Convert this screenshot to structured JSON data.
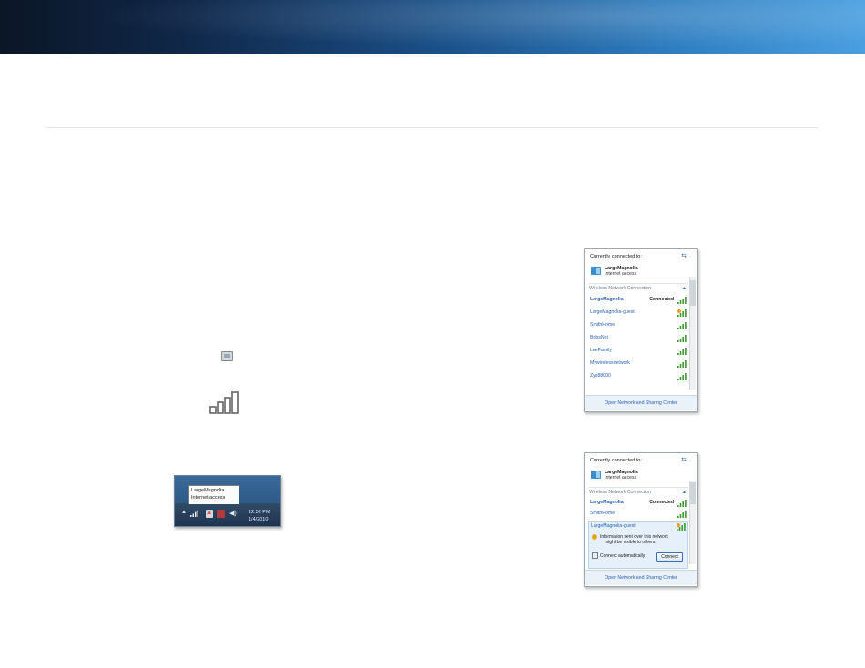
{
  "tray": {
    "tooltip_name": "LargeMagnolia",
    "tooltip_status": "Internet access",
    "time": "12:52 PM",
    "date": "1/4/2010"
  },
  "panel_a": {
    "header": "Currently connected to:",
    "connected_name": "LargeMagnolia",
    "connected_status": "Internet access",
    "section": "Wireless Network Connection",
    "networks": [
      {
        "name": "LargeMagnolia",
        "status": "Connected"
      },
      {
        "name": "LargeMagnolia-guest",
        "status": ""
      },
      {
        "name": "SmithHome",
        "status": ""
      },
      {
        "name": "BobsNet",
        "status": ""
      },
      {
        "name": "LeeFamily",
        "status": ""
      },
      {
        "name": "Mywirelessnetwork",
        "status": ""
      },
      {
        "name": "Zyx88000",
        "status": ""
      }
    ],
    "footer": "Open Network and Sharing Center"
  },
  "panel_b": {
    "header": "Currently connected to:",
    "connected_name": "LargeMagnolia",
    "connected_status": "Internet access",
    "section": "Wireless Network Connection",
    "networks": [
      {
        "name": "LargeMagnolia",
        "status": "Connected"
      },
      {
        "name": "SmithHome",
        "status": ""
      }
    ],
    "selected_network": "LargeMagnolia-guest",
    "warning_line1": "Information sent over this network",
    "warning_line2": "might be visible to others.",
    "auto_label": "Connect automatically",
    "connect_button": "Connect",
    "footer": "Open Network and Sharing Center"
  }
}
